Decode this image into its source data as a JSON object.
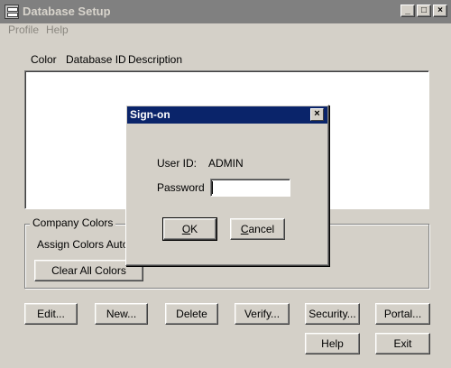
{
  "window": {
    "title": "Database Setup",
    "minimize_glyph": "_",
    "maximize_glyph": "□",
    "close_glyph": "×"
  },
  "menu": [
    "Profile",
    "Help"
  ],
  "list": {
    "columns": [
      "Color",
      "Database ID",
      "Description"
    ]
  },
  "company_colors": {
    "legend": "Company Colors",
    "assign_label": "Assign Colors Autom",
    "clear_button": "Clear All Colors"
  },
  "buttons": {
    "edit": "Edit...",
    "new": "New...",
    "delete": "Delete",
    "verify": "Verify...",
    "security": "Security...",
    "portal": "Portal...",
    "help": "Help",
    "exit": "Exit"
  },
  "signon": {
    "title": "Sign-on",
    "close_glyph": "×",
    "user_id_label": "User ID:",
    "user_id_value": "ADMIN",
    "password_label": "Password",
    "password_value": "",
    "ok_mnemonic": "O",
    "ok_rest": "K",
    "cancel_mnemonic": "C",
    "cancel_rest": "ancel"
  }
}
